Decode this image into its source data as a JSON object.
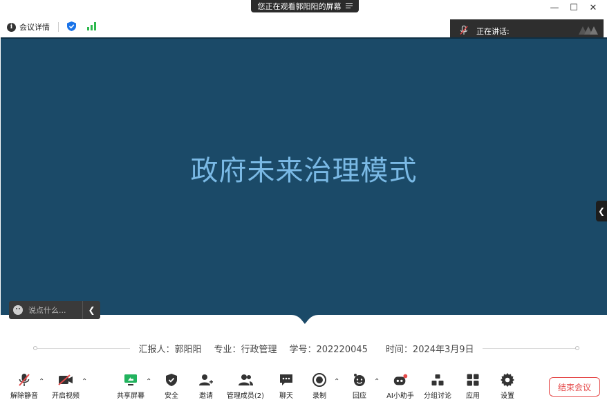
{
  "share_banner": {
    "text": "您正在观看郭阳阳的屏幕"
  },
  "window_controls": {
    "minimize": "—",
    "maximize": "☐",
    "close": "✕"
  },
  "topbar": {
    "meeting_details": "会议详情"
  },
  "speaking_panel": {
    "label": "正在讲话:"
  },
  "slide": {
    "title": "政府未来治理模式",
    "reporter": "汇报人：郭阳阳",
    "major": "专业：行政管理",
    "student_id": "学号：202220045",
    "date": "时间：2024年3月9日"
  },
  "chat": {
    "placeholder": "说点什么..."
  },
  "toolbar": {
    "unmute": "解除静音",
    "start_video": "开启视频",
    "share_screen": "共享屏幕",
    "security": "安全",
    "invite": "邀请",
    "manage_members": "管理成员(2)",
    "chat": "聊天",
    "record": "录制",
    "reactions": "回应",
    "ai_assistant": "AI小助手",
    "breakout": "分组讨论",
    "apps": "应用",
    "settings": "设置",
    "end_meeting": "结束会议"
  },
  "colors": {
    "slide_bg": "#1b4a68",
    "slide_title": "#7ab9e5",
    "end_button": "#e54a4a",
    "security_blue": "#1a73e8",
    "signal_green": "#2db84d",
    "share_green": "#22b35e"
  }
}
